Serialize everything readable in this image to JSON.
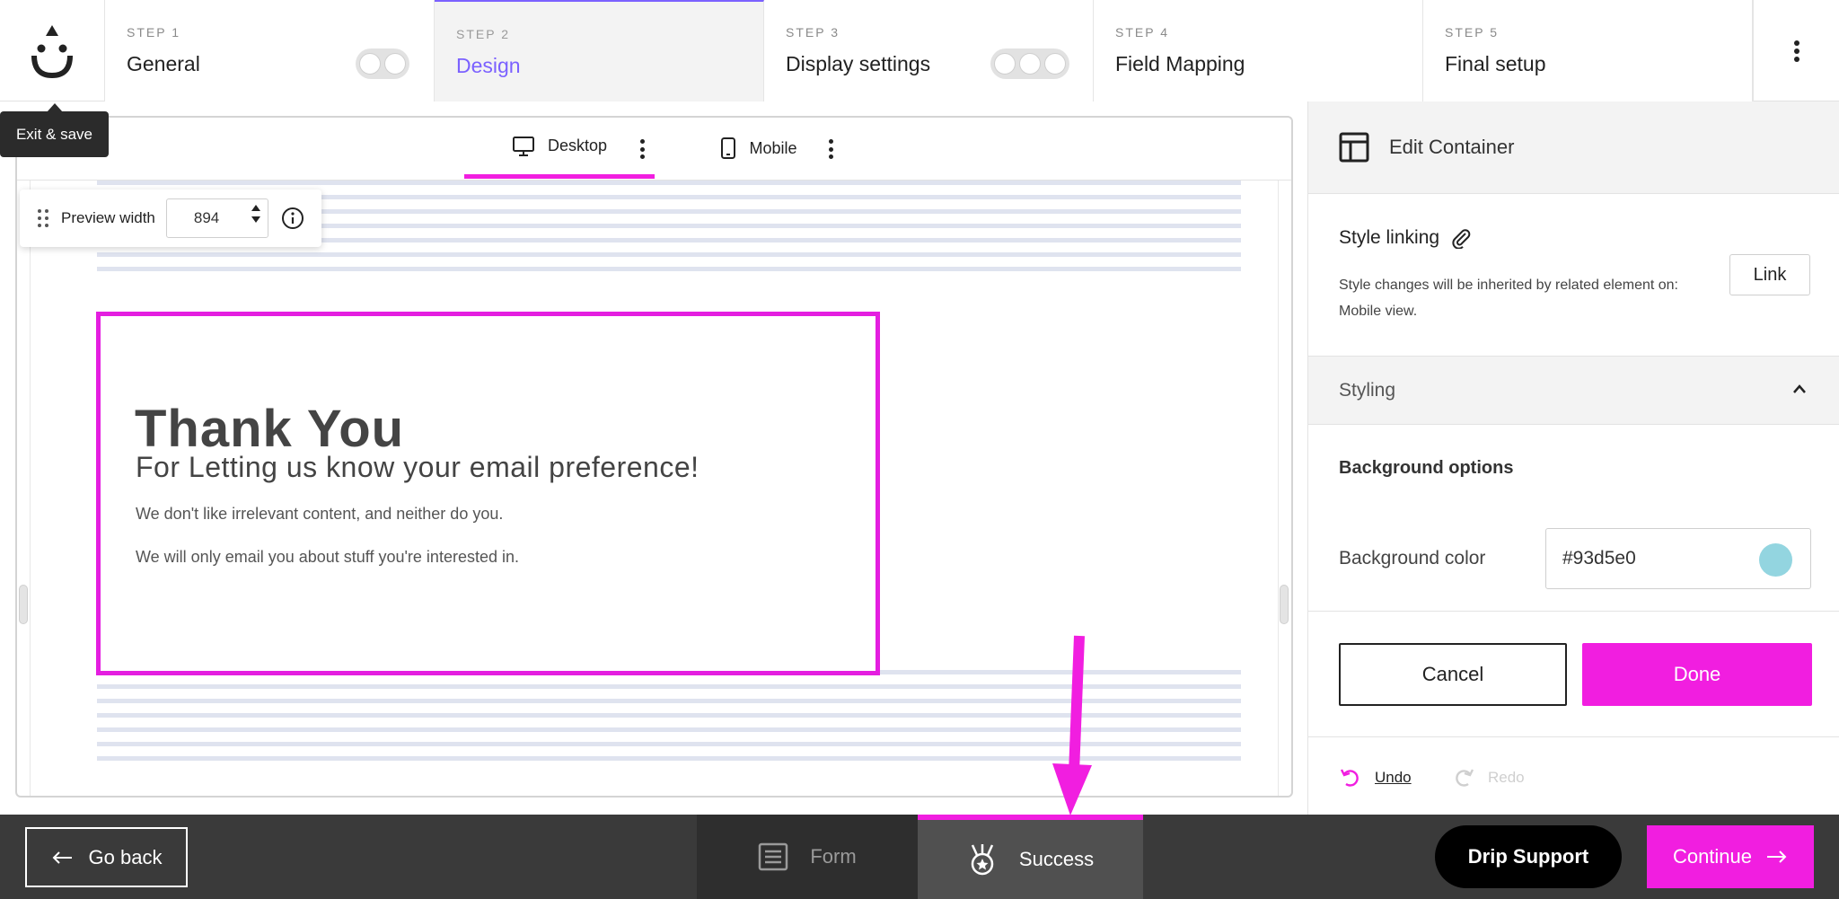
{
  "tooltip": "Exit & save",
  "steps": [
    {
      "num": "STEP 1",
      "name": "General"
    },
    {
      "num": "STEP 2",
      "name": "Design"
    },
    {
      "num": "STEP 3",
      "name": "Display settings"
    },
    {
      "num": "STEP 4",
      "name": "Field Mapping"
    },
    {
      "num": "STEP 5",
      "name": "Final setup"
    }
  ],
  "device_tabs": {
    "desktop": "Desktop",
    "mobile": "Mobile"
  },
  "preview": {
    "label": "Preview width",
    "value": "894"
  },
  "thank_you": {
    "title": "Thank You",
    "subtitle": "For Letting us know your email preference!",
    "line1": "We don't like irrelevant content, and neither do you.",
    "line2": "We will only email you about stuff you're interested in."
  },
  "panel": {
    "title": "Edit Container",
    "style_linking": "Style linking",
    "style_desc": "Style changes will be inherited by related element on: Mobile view.",
    "link_button": "Link",
    "styling": "Styling",
    "bg_options": "Background options",
    "bg_color_label": "Background color",
    "bg_color_value": "#93d5e0",
    "cancel": "Cancel",
    "done": "Done",
    "undo": "Undo",
    "redo": "Redo"
  },
  "bottom": {
    "go_back": "Go back",
    "form": "Form",
    "success": "Success",
    "drip_support": "Drip Support",
    "continue": "Continue"
  },
  "colors": {
    "accent": "#f11ee0",
    "active_step": "#7b61ff",
    "swatch": "#93d5e0"
  }
}
